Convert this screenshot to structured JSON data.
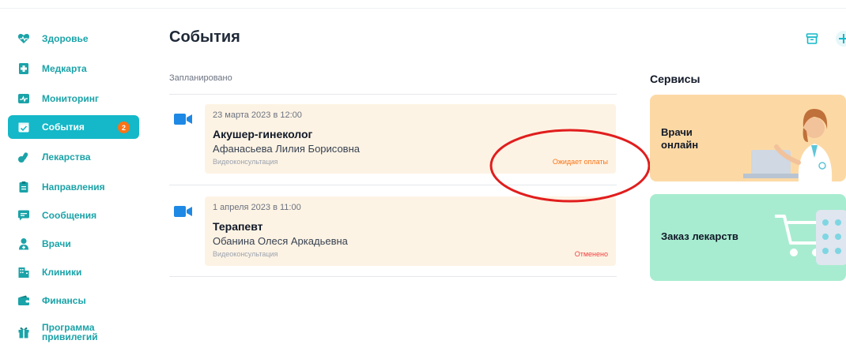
{
  "sidebar": {
    "items": [
      {
        "label": "Здоровье",
        "icon": "heart-pulse-icon",
        "active": false
      },
      {
        "label": "Медкарта",
        "icon": "medical-card-icon",
        "active": false
      },
      {
        "label": "Мониторинг",
        "icon": "monitoring-icon",
        "active": false
      },
      {
        "label": "События",
        "icon": "calendar-check-icon",
        "active": true,
        "badge": "2"
      },
      {
        "label": "Лекарства",
        "icon": "pills-icon",
        "active": false
      },
      {
        "label": "Направления",
        "icon": "clipboard-icon",
        "active": false
      },
      {
        "label": "Сообщения",
        "icon": "chat-icon",
        "active": false
      },
      {
        "label": "Врачи",
        "icon": "doctor-icon",
        "active": false
      },
      {
        "label": "Клиники",
        "icon": "clinic-building-icon",
        "active": false
      },
      {
        "label": "Финансы",
        "icon": "wallet-icon",
        "active": false
      },
      {
        "label": "Программа привилегий",
        "icon": "gift-icon",
        "active": false
      }
    ]
  },
  "main": {
    "title": "События",
    "section_label": "Запланировано",
    "events": [
      {
        "date": "23 марта 2023 в 12:00",
        "specialty": "Акушер-гинеколог",
        "doctor": "Афанасьева Лилия Борисовна",
        "type": "Видеоконсультация",
        "status": "Ожидает оплаты",
        "status_color": "#f97316",
        "icon": "video-camera-icon"
      },
      {
        "date": "1 апреля 2023 в 11:00",
        "specialty": "Терапевт",
        "doctor": "Обанина Олеся Аркадьевна",
        "type": "Видеоконсультация",
        "status": "Отменено",
        "status_color": "#ef4444",
        "icon": "video-camera-icon"
      }
    ]
  },
  "services": {
    "title": "Сервисы",
    "items": [
      {
        "label": "Врачи\nонлайн",
        "bg": "#fcd9a4",
        "icon": "doctor-illustration-icon"
      },
      {
        "label": "Заказ лекарств",
        "bg": "#a7ecd0",
        "icon": "shopping-cart-icon"
      }
    ]
  },
  "toolbar": {
    "archive_icon": "archive-icon",
    "add_icon": "plus-icon"
  },
  "colors": {
    "accent": "#14b8c8",
    "nav_text": "#1aa3a8",
    "badge": "#f97316",
    "card_bg": "#fdf3e4",
    "annotation": "#e11d1d"
  }
}
